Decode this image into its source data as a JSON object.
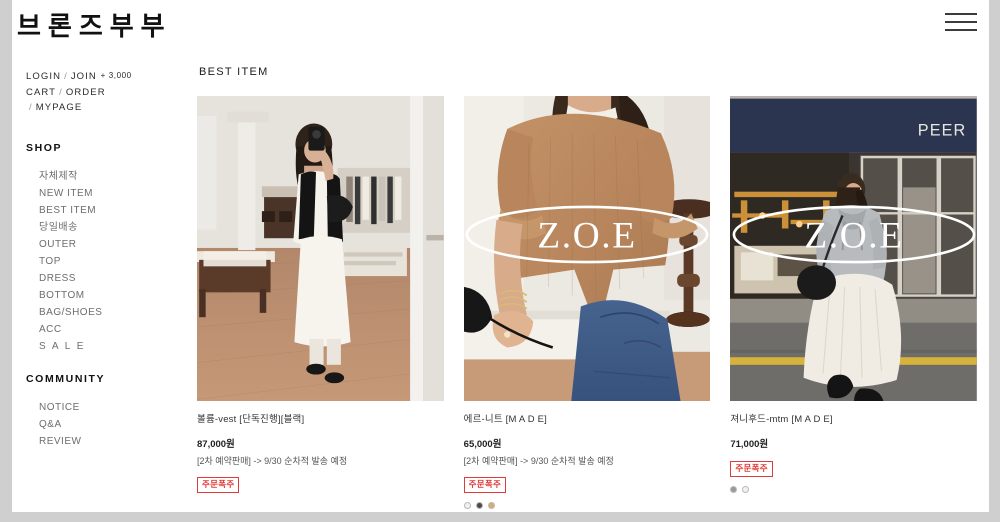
{
  "header": {
    "brand": "브론즈부부",
    "menu_icon": "hamburger-icon"
  },
  "sidebar": {
    "account": {
      "login": "LOGIN",
      "join": "JOIN",
      "bonus": "+ 3,000",
      "cart": "CART",
      "order": "ORDER",
      "mypage": "MYPAGE",
      "separator": "/"
    },
    "groups": [
      {
        "title": "SHOP",
        "items": [
          {
            "label": "자체제작"
          },
          {
            "label": "NEW ITEM"
          },
          {
            "label": "BEST ITEM"
          },
          {
            "label": "당일배송"
          },
          {
            "label": "OUTER"
          },
          {
            "label": "TOP"
          },
          {
            "label": "DRESS"
          },
          {
            "label": "BOTTOM"
          },
          {
            "label": "BAG/SHOES"
          },
          {
            "label": "ACC"
          },
          {
            "label": "S A L E"
          }
        ]
      },
      {
        "title": "COMMUNITY",
        "items": [
          {
            "label": "NOTICE"
          },
          {
            "label": "Q&A"
          },
          {
            "label": "REVIEW"
          }
        ]
      }
    ]
  },
  "main": {
    "section_title": "BEST ITEM",
    "products": [
      {
        "name": "볼륨-vest [단독진행][블랙]",
        "price": "87,000원",
        "note": "[2차 예약판매] -> 9/30 순차적 발송 예정",
        "badge": "주문폭주",
        "image_alt": "mirror-selfie-white-dress-black-vest",
        "colors": []
      },
      {
        "name": "에르-니트 [M A D E]",
        "price": "65,000원",
        "note": "[2차 예약판매] -> 9/30 순차적 발송 예정",
        "badge": "주문폭주",
        "image_alt": "camel-knit-top-blue-jeans",
        "watermark": "Z.O.E",
        "colors": [
          "#f5f0e8",
          "#4a4a4a",
          "#d6ad70"
        ]
      },
      {
        "name": "져니후드-mtm [M A D E]",
        "price": "71,000원",
        "note": "",
        "badge": "주문폭주",
        "image_alt": "street-style-grey-hoodie-white-skirt",
        "watermark": "Z.O.E",
        "store_sign": "PEER",
        "colors": [
          "#9a9a9a",
          "#f2f2f2"
        ]
      }
    ]
  },
  "colors": {
    "badge": "#e03a3a",
    "page_background": "#cfcfcf",
    "content_background": "#ffffff"
  }
}
